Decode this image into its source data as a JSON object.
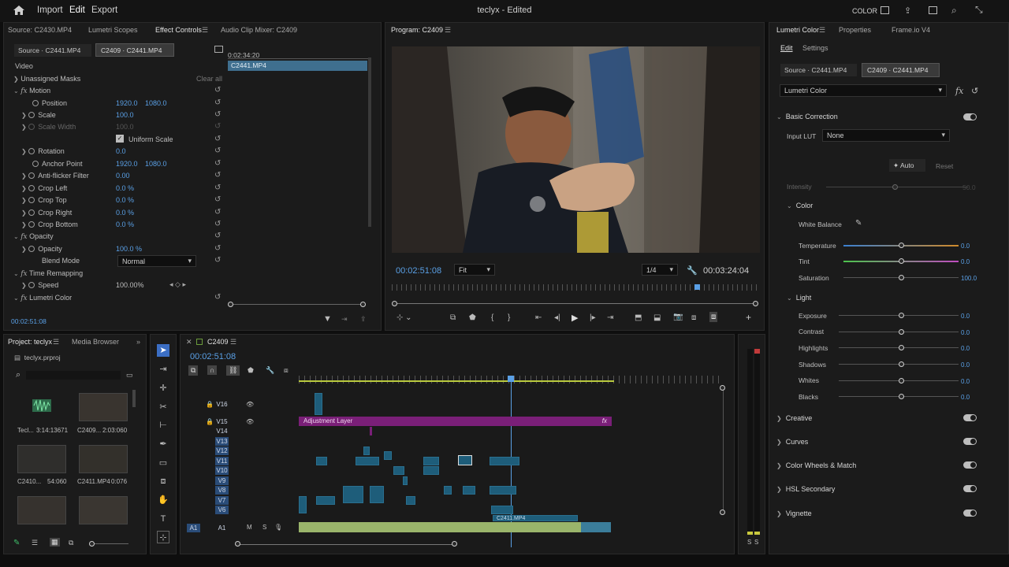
{
  "topbar": {
    "home": "home-icon",
    "import": "Import",
    "edit": "Edit",
    "export": "Export",
    "title": "teclyx - Edited",
    "color_mode": "COLOR"
  },
  "source_panel": {
    "tabs": [
      "Source: C2430.MP4",
      "Lumetri Scopes",
      "Effect Controls",
      "Audio Clip Mixer: C2409"
    ],
    "source_tab": "Source · C2441.MP4",
    "seq_tab": "C2409 · C2441.MP4",
    "timecode_ruler": "0:02:34:20",
    "clip_label": "C2441.MP4",
    "video_label": "Video",
    "masks_label": "Unassigned Masks",
    "clear_all": "Clear all",
    "motion": "Motion",
    "params": [
      {
        "name": "Position",
        "v1": "1920.0",
        "v2": "1080.0"
      },
      {
        "name": "Scale",
        "v1": "100.0"
      },
      {
        "name": "Scale Width",
        "v1": "100.0"
      },
      {
        "name": "Rotation",
        "v1": "0.0"
      },
      {
        "name": "Anchor Point",
        "v1": "1920.0",
        "v2": "1080.0"
      },
      {
        "name": "Anti-flicker Filter",
        "v1": "0.00"
      },
      {
        "name": "Crop Left",
        "v1": "0.0 %"
      },
      {
        "name": "Crop Top",
        "v1": "0.0 %"
      },
      {
        "name": "Crop Right",
        "v1": "0.0 %"
      },
      {
        "name": "Crop Bottom",
        "v1": "0.0 %"
      }
    ],
    "uniform_scale": "Uniform Scale",
    "opacity_section": "Opacity",
    "opacity_label": "Opacity",
    "opacity_value": "100.0 %",
    "blend_label": "Blend Mode",
    "blend_value": "Normal",
    "time_remap": "Time Remapping",
    "speed_label": "Speed",
    "speed_value": "100.00%",
    "lumetri": "Lumetri Color",
    "timecode": "00:02:51:08"
  },
  "program_panel": {
    "title": "Program: C2409",
    "timecode": "00:02:51:08",
    "fit": "Fit",
    "quality": "1/4",
    "duration": "00:03:24:04"
  },
  "lumetri_panel": {
    "tabs": [
      "Lumetri Color",
      "Properties",
      "Frame.io V4"
    ],
    "subtabs": [
      "Edit",
      "Settings"
    ],
    "source_tab": "Source · C2441.MP4",
    "seq_tab": "C2409 · C2441.MP4",
    "effect_select": "Lumetri Color",
    "basic": "Basic Correction",
    "input_lut": "Input LUT",
    "lut_value": "None",
    "auto": "Auto",
    "reset": "Reset",
    "intensity": "Intensity",
    "intensity_value": "50.0",
    "color": "Color",
    "white_balance": "White Balance",
    "color_rows": [
      {
        "name": "Temperature",
        "value": "0.0"
      },
      {
        "name": "Tint",
        "value": "0.0"
      },
      {
        "name": "Saturation",
        "value": "100.0"
      }
    ],
    "light": "Light",
    "light_rows": [
      {
        "name": "Exposure",
        "value": "0.0"
      },
      {
        "name": "Contrast",
        "value": "0.0"
      },
      {
        "name": "Highlights",
        "value": "0.0"
      },
      {
        "name": "Shadows",
        "value": "0.0"
      },
      {
        "name": "Whites",
        "value": "0.0"
      },
      {
        "name": "Blacks",
        "value": "0.0"
      }
    ],
    "sections": [
      "Creative",
      "Curves",
      "Color Wheels & Match",
      "HSL Secondary",
      "Vignette"
    ]
  },
  "project_panel": {
    "tabs": [
      "Project: teclyx",
      "Media Browser"
    ],
    "file": "teclyx.prproj",
    "items": [
      {
        "name": "Tecl...",
        "dur": "3:14:13671"
      },
      {
        "name": "C2409...",
        "dur": "2:03:060"
      },
      {
        "name": "C2410...",
        "dur": "54:060"
      },
      {
        "name": "C2411.MP4",
        "dur": "0:076"
      }
    ]
  },
  "timeline": {
    "title": "C2409",
    "timecode": "00:02:51:08",
    "video_tracks": [
      "V16",
      "V15",
      "V14",
      "V13",
      "V12",
      "V11",
      "V10",
      "V9",
      "V8",
      "V7",
      "V6"
    ],
    "audio_track": "A1",
    "adjustment_layer": "Adjustment Layer",
    "clip_label": "C2411.MP4"
  },
  "meter": {
    "labels": [
      "S",
      "S"
    ]
  },
  "colors": {
    "accent": "#5aa0e6",
    "adjustment": "#7a1f78",
    "clip": "#1e5d7a",
    "audio": "#9ab56b",
    "playhead": "#5aa0e6"
  }
}
